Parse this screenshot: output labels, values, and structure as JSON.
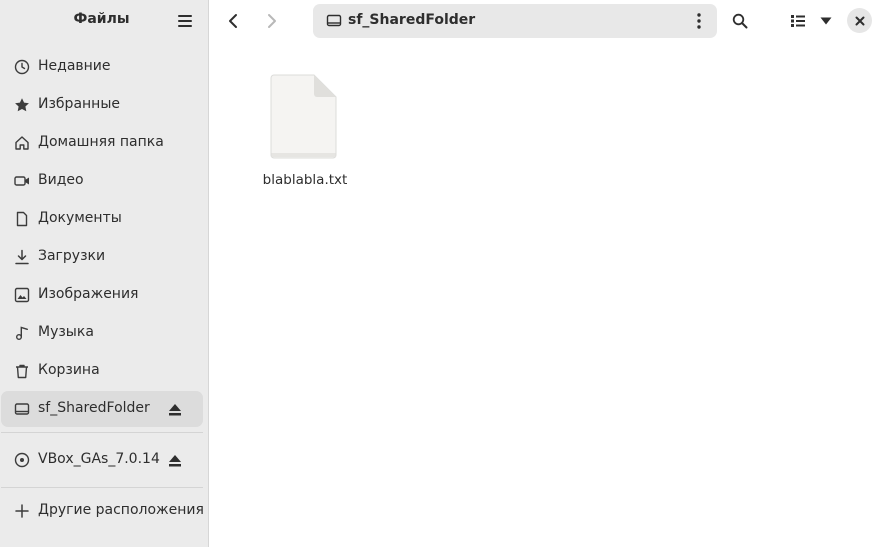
{
  "sidebar": {
    "title": "Файлы",
    "places": [
      {
        "label": "Недавние",
        "icon": "clock-icon"
      },
      {
        "label": "Избранные",
        "icon": "star-icon"
      },
      {
        "label": "Домашняя папка",
        "icon": "home-icon"
      },
      {
        "label": "Видео",
        "icon": "video-icon"
      },
      {
        "label": "Документы",
        "icon": "document-icon"
      },
      {
        "label": "Загрузки",
        "icon": "download-icon"
      },
      {
        "label": "Изображения",
        "icon": "image-icon"
      },
      {
        "label": "Музыка",
        "icon": "music-icon"
      },
      {
        "label": "Корзина",
        "icon": "trash-icon"
      }
    ],
    "devices": [
      {
        "label": "sf_SharedFolder",
        "icon": "drive-icon",
        "active": true
      },
      {
        "label": "VBox_GAs_7.0.14",
        "icon": "disc-icon",
        "active": false
      }
    ],
    "other_locations": {
      "label": "Другие расположения",
      "icon": "plus-icon"
    }
  },
  "header": {
    "path_label": "sf_SharedFolder"
  },
  "files": [
    {
      "name": "blablabla.txt",
      "icon": "text-file-icon"
    }
  ],
  "colors": {
    "sidebar_bg": "#ebebeb",
    "active_item_bg": "#dcdcdc",
    "pathbar_bg": "#e8e8e8",
    "text": "#2e2e2e"
  }
}
